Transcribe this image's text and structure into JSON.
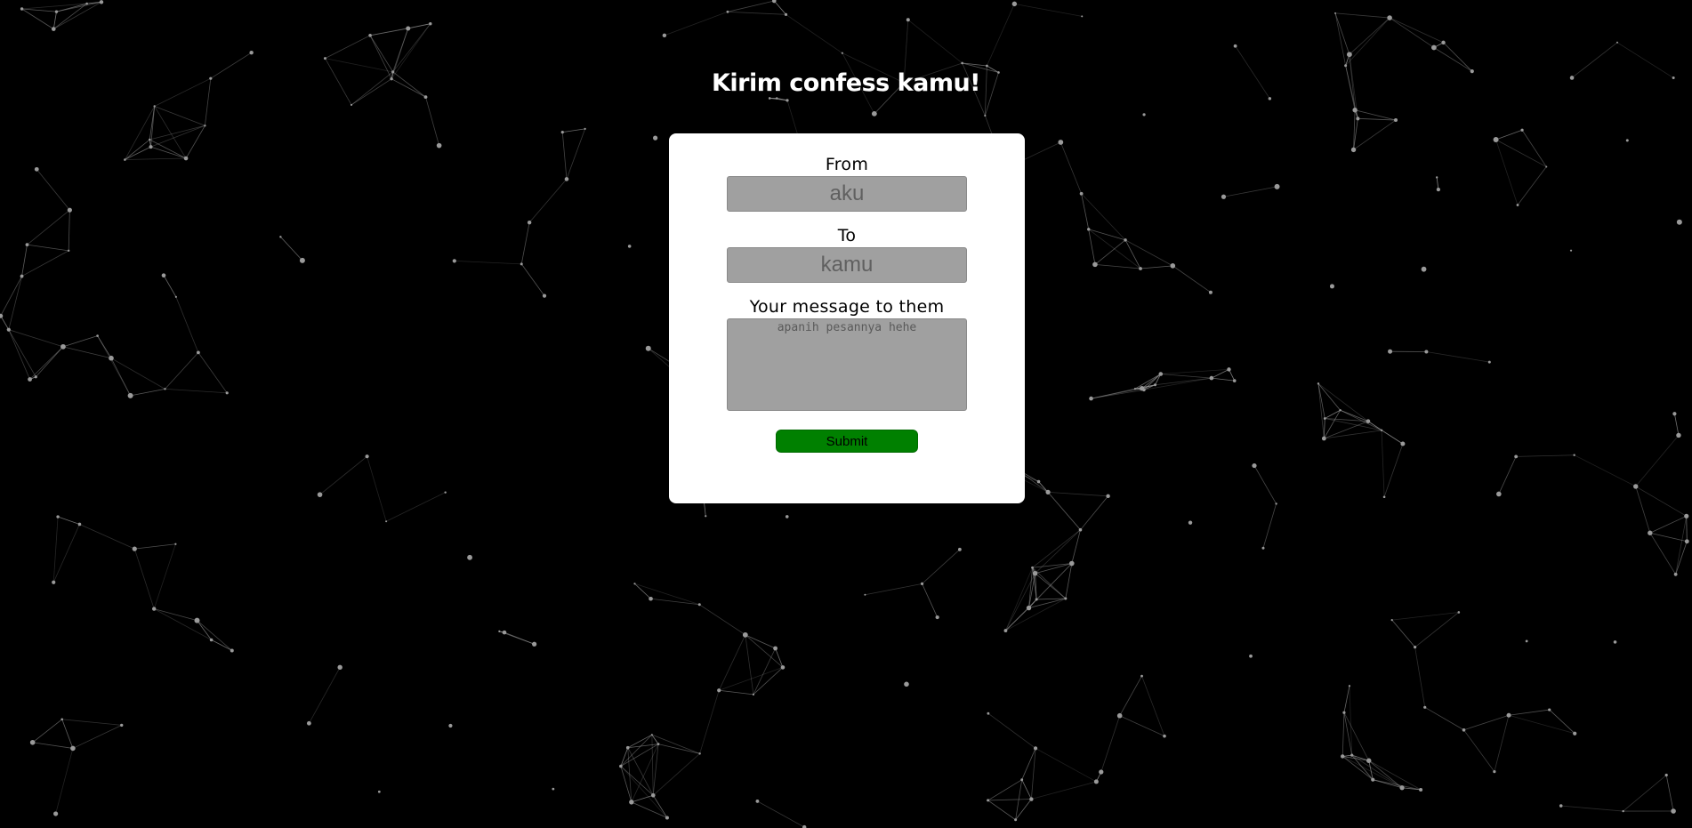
{
  "page": {
    "title": "Kirim confess kamu!"
  },
  "form": {
    "from": {
      "label": "From",
      "placeholder": "aku",
      "value": ""
    },
    "to": {
      "label": "To",
      "placeholder": "kamu",
      "value": ""
    },
    "message": {
      "label": "Your message to them",
      "placeholder": "apanih pesannya hehe",
      "value": ""
    },
    "submit_label": "Submit"
  },
  "colors": {
    "background": "#000000",
    "card": "#ffffff",
    "input_fill": "#a0a0a0",
    "submit": "#008000",
    "particles": "#9a9a9a"
  }
}
